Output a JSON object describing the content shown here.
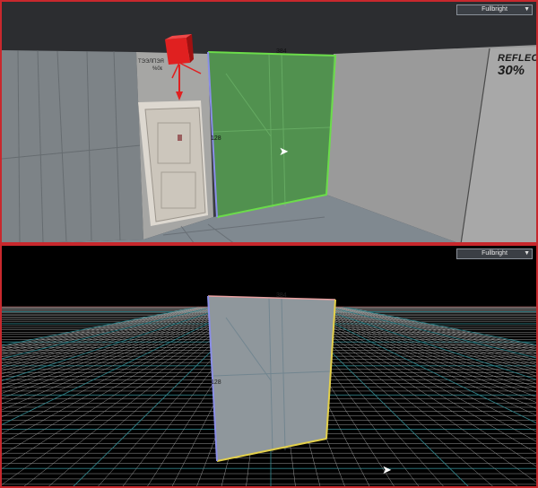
{
  "viewports": {
    "top": {
      "render_mode": "Fullbright"
    },
    "bottom": {
      "render_mode": "Fullbright"
    }
  },
  "brush": {
    "width_label": "384",
    "height_label": "128"
  },
  "wall_sign": {
    "line1": "REFLECT",
    "line2": "30%"
  },
  "icons": {
    "dropdown": "chevron-down-icon",
    "cursor": "mouse-pointer-icon",
    "entity_marker": "info-light-entity-icon"
  },
  "colors": {
    "viewport_border": "#c8282d",
    "selection_fill": "#4fa34f",
    "selection_outline": "#6bdc4a",
    "edge_x": "#e3d04a",
    "edge_y": "#8a8ee8"
  }
}
